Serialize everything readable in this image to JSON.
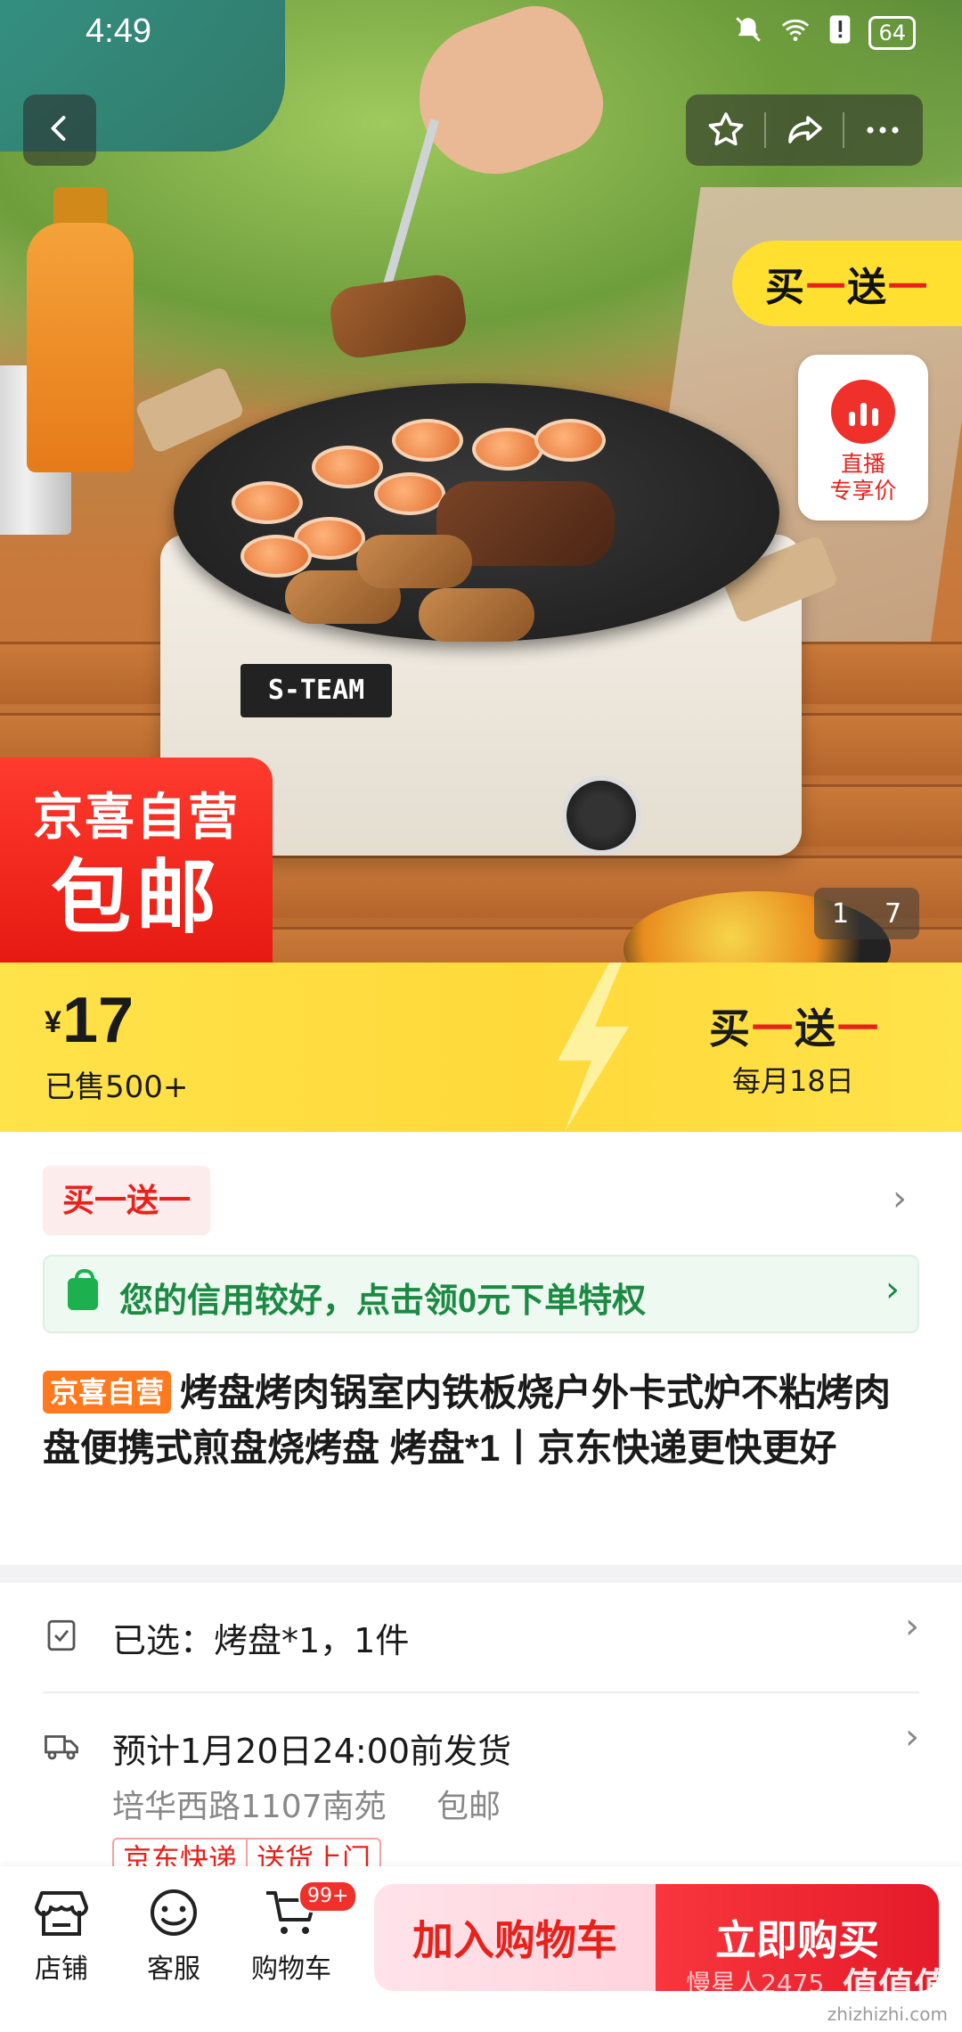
{
  "status_bar": {
    "time": "4:49",
    "battery": "64"
  },
  "hero": {
    "promo_tag": {
      "part1": "买",
      "part2": "一",
      "part3": "送",
      "part4": "一"
    },
    "live_badge": {
      "line1": "直播",
      "line2": "专享价"
    },
    "self_badge": {
      "line1": "京喜自营",
      "line2": "包邮"
    },
    "pager": {
      "current": "1",
      "total": "7"
    },
    "stove_brand": "S-TEAM"
  },
  "price_band": {
    "currency": "¥",
    "price": "17",
    "sold": "已售500+",
    "promo": {
      "part1": "买",
      "part2": "一",
      "part3": "送",
      "part4": "一"
    },
    "schedule": "每月18日"
  },
  "product": {
    "bogo_tag": "买一送一",
    "credit_notice": "您的信用较好，点击领0元下单特权",
    "self_label": "京喜自营",
    "title": "烤盘烤肉锅室内铁板烧户外卡式炉不粘烤肉盘便携式煎盘烧烤盘 烤盘*1丨京东快递更快更好"
  },
  "options": {
    "selected": "已选：烤盘*1，1件",
    "delivery": "预计1月20日24:00前发货",
    "address": "培华西路1107南苑",
    "free_shipping": "包邮",
    "tags": [
      "京东快递",
      "送货上门"
    ]
  },
  "bottom_bar": {
    "tabs": [
      {
        "label": "店铺",
        "icon": "store-icon"
      },
      {
        "label": "客服",
        "icon": "customer-service-icon"
      },
      {
        "label": "购物车",
        "icon": "cart-icon",
        "badge": "99+"
      }
    ],
    "add_to_cart": "加入购物车",
    "buy_now": "立即购买"
  },
  "watermark": {
    "text": "慢星人2475",
    "logo": "值值值",
    "url": "zhizhizhi.com"
  },
  "colors": {
    "accent_red": "#e8221b",
    "promo_yellow": "#ffe034",
    "credit_green": "#1b8a42"
  }
}
